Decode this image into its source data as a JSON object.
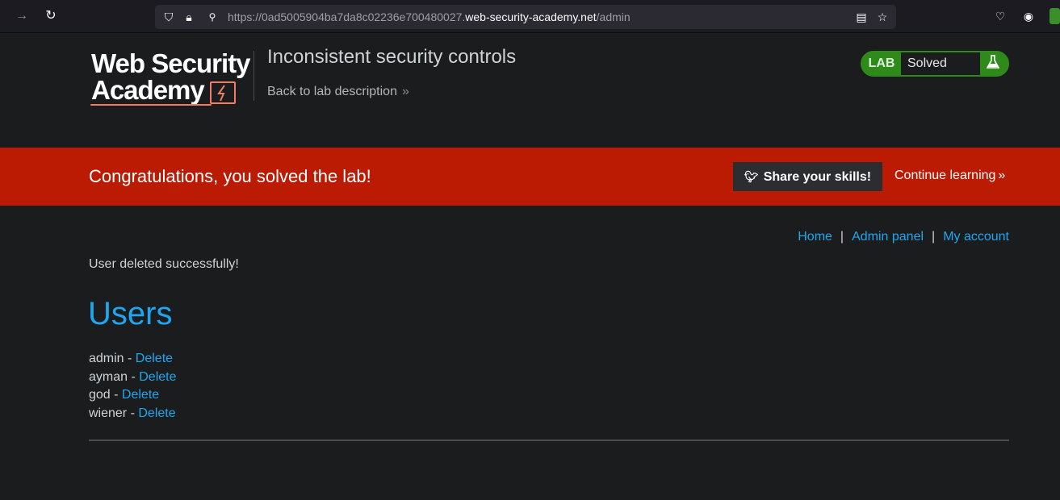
{
  "browser": {
    "url_prefix": "https://0ad5005904ba7da8c02236e700480027.",
    "url_host": "web-security-academy.net",
    "url_path": "/admin"
  },
  "header": {
    "logo_line1": "Web Security",
    "logo_line2": "Academy",
    "lab_title": "Inconsistent security controls",
    "back_link": "Back to lab description",
    "lab_tag": "LAB",
    "lab_state": "Solved"
  },
  "banner": {
    "message": "Congratulations, you solved the lab!",
    "share_label": "Share your skills!",
    "continue_label": "Continue learning"
  },
  "nav": {
    "home": "Home",
    "admin_panel": "Admin panel",
    "my_account": "My account",
    "separator": "|"
  },
  "main": {
    "status_message": "User deleted successfully!",
    "heading": "Users",
    "users": [
      {
        "name": "admin",
        "action": "Delete"
      },
      {
        "name": "ayman",
        "action": "Delete"
      },
      {
        "name": "god",
        "action": "Delete"
      },
      {
        "name": "wiener",
        "action": "Delete"
      }
    ]
  },
  "colors": {
    "accent": "#1ea7f0",
    "banner": "#bb1a03",
    "solved": "#2e8b1a",
    "background": "#1a1c1e"
  }
}
